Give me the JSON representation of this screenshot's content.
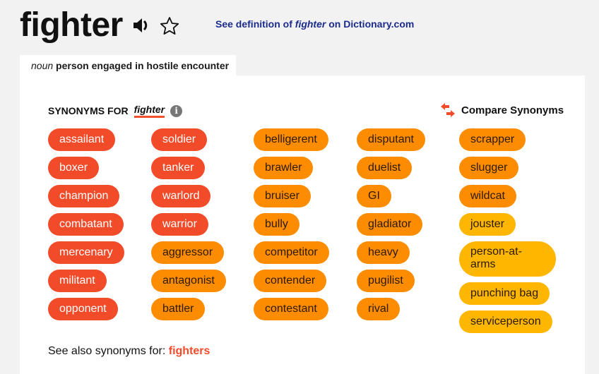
{
  "header": {
    "headword": "fighter",
    "speaker_icon": "speaker-icon",
    "star_icon": "star-outline-icon",
    "dictionary_link": {
      "prefix": "See definition of ",
      "word": "fighter",
      "suffix": " on Dictionary.com"
    }
  },
  "sense_tab": {
    "part_of_speech": "noun",
    "definition": "person engaged in hostile encounter"
  },
  "synonyms": {
    "heading": "SYNONYMS FOR",
    "word": "fighter",
    "info_icon": "info-icon",
    "compare_label": "Compare Synonyms",
    "compare_icon": "swap-arrows-icon",
    "colors": {
      "strongest": "#f24b29",
      "strong": "#fe8c00",
      "weak": "#ffb600"
    },
    "columns": [
      [
        {
          "label": "assailant",
          "relevance": "strongest"
        },
        {
          "label": "boxer",
          "relevance": "strongest"
        },
        {
          "label": "champion",
          "relevance": "strongest"
        },
        {
          "label": "combatant",
          "relevance": "strongest"
        },
        {
          "label": "mercenary",
          "relevance": "strongest"
        },
        {
          "label": "militant",
          "relevance": "strongest"
        },
        {
          "label": "opponent",
          "relevance": "strongest"
        }
      ],
      [
        {
          "label": "soldier",
          "relevance": "strongest"
        },
        {
          "label": "tanker",
          "relevance": "strongest"
        },
        {
          "label": "warlord",
          "relevance": "strongest"
        },
        {
          "label": "warrior",
          "relevance": "strongest"
        },
        {
          "label": "aggressor",
          "relevance": "strong"
        },
        {
          "label": "antagonist",
          "relevance": "strong"
        },
        {
          "label": "battler",
          "relevance": "strong"
        }
      ],
      [
        {
          "label": "belligerent",
          "relevance": "strong"
        },
        {
          "label": "brawler",
          "relevance": "strong"
        },
        {
          "label": "bruiser",
          "relevance": "strong"
        },
        {
          "label": "bully",
          "relevance": "strong"
        },
        {
          "label": "competitor",
          "relevance": "strong"
        },
        {
          "label": "contender",
          "relevance": "strong"
        },
        {
          "label": "contestant",
          "relevance": "strong"
        }
      ],
      [
        {
          "label": "disputant",
          "relevance": "strong"
        },
        {
          "label": "duelist",
          "relevance": "strong"
        },
        {
          "label": "GI",
          "relevance": "strong"
        },
        {
          "label": "gladiator",
          "relevance": "strong"
        },
        {
          "label": "heavy",
          "relevance": "strong"
        },
        {
          "label": "pugilist",
          "relevance": "strong"
        },
        {
          "label": "rival",
          "relevance": "strong"
        }
      ],
      [
        {
          "label": "scrapper",
          "relevance": "strong"
        },
        {
          "label": "slugger",
          "relevance": "strong"
        },
        {
          "label": "wildcat",
          "relevance": "strong"
        },
        {
          "label": "jouster",
          "relevance": "weak"
        },
        {
          "label": "person-at-arms",
          "relevance": "weak"
        },
        {
          "label": "punching bag",
          "relevance": "weak"
        },
        {
          "label": "serviceperson",
          "relevance": "weak"
        }
      ]
    ]
  },
  "see_also": {
    "label": "See also synonyms for: ",
    "link": "fighters"
  }
}
